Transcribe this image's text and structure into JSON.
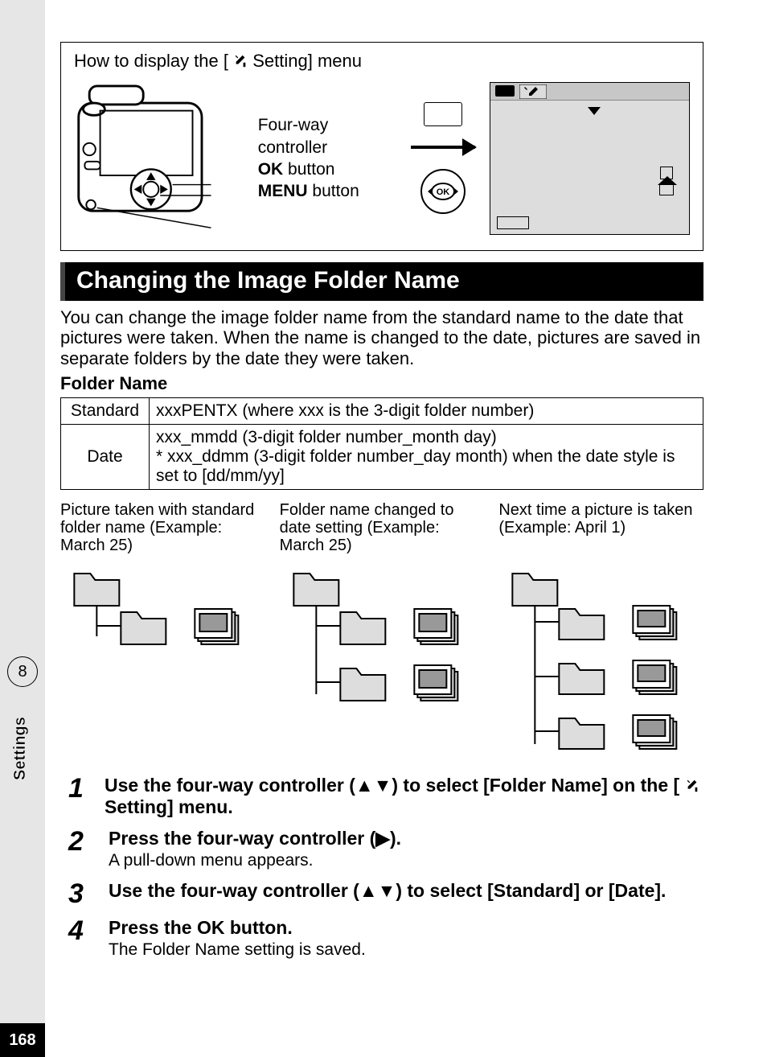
{
  "chapter": {
    "number": "8",
    "label": "Settings",
    "page": "168"
  },
  "topbox": {
    "caption_pre": "How to display the [",
    "caption_post": " Setting] menu",
    "line1": "Four-way controller",
    "line2_bold": "OK",
    "line2_rest": "  button",
    "line3_bold": "MENU",
    "line3_rest": " button"
  },
  "section_title": "Changing the Image Folder Name",
  "intro": "You can change the image folder name from the standard name to the date that pictures were taken. When the name is changed to the date, pictures are saved in separate folders by the date they were taken.",
  "folder_name_heading": "Folder Name",
  "table": {
    "r1c1": "Standard",
    "r1c2": "xxxPENTX (where xxx is the 3-digit folder number)",
    "r2c1": "Date",
    "r2c2": "xxx_mmdd (3-digit folder number_month day)\n* xxx_ddmm (3-digit folder number_day month) when the date style is set to [dd/mm/yy]"
  },
  "cols": {
    "c1": "Picture taken with standard folder name (Example: March 25)",
    "c2": "Folder name changed to date setting (Example: March 25)",
    "c3": "Next time a picture is taken (Example: April 1)"
  },
  "steps": {
    "s1": "Use the four-way controller (▲▼) to select [Folder Name] on the [",
    "s1_post": " Setting] menu.",
    "s2": "Press the four-way controller (▶).",
    "s2_sub": "A pull-down menu appears.",
    "s3": "Use the four-way controller (▲▼) to select [Standard] or [Date].",
    "s4_pre": "Press the ",
    "s4_ok": "OK",
    "s4_post": "  button.",
    "s4_sub": "The Folder Name setting is saved."
  }
}
